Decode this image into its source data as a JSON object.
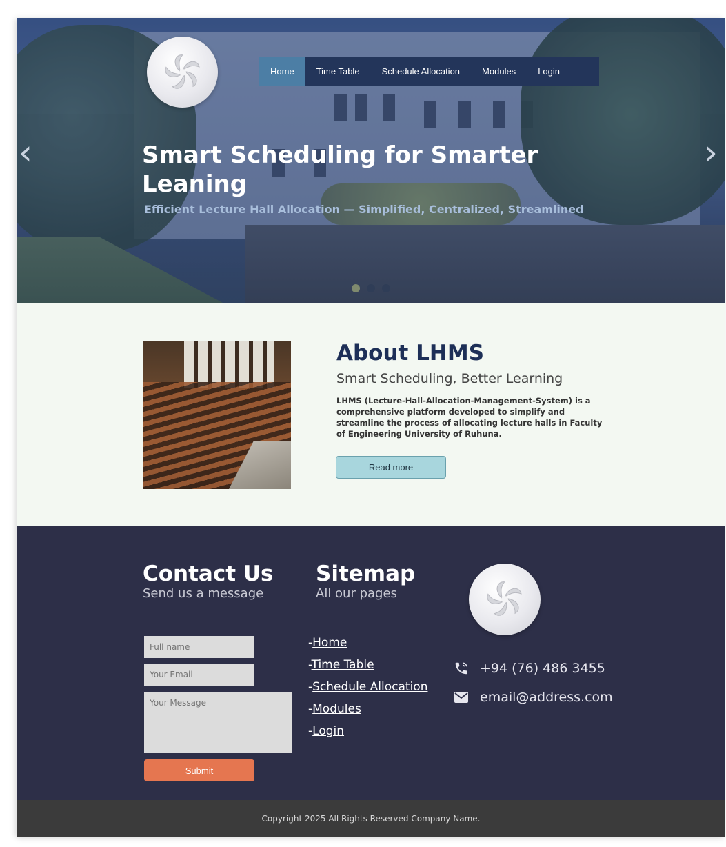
{
  "nav": {
    "items": [
      {
        "label": "Home",
        "active": true
      },
      {
        "label": "Time Table"
      },
      {
        "label": "Schedule Allocation"
      },
      {
        "label": "Modules"
      },
      {
        "label": "Login"
      }
    ]
  },
  "hero": {
    "title": "Smart Scheduling for Smarter Leaning",
    "subtitle": "Efficient Lecture Hall Allocation — Simplified, Centralized, Streamlined",
    "prev_icon": "chevron-left-icon",
    "next_icon": "chevron-right-icon",
    "slide_count": 3,
    "active_slide": 1
  },
  "about": {
    "title": "About LHMS",
    "subtitle": "Smart Scheduling, Better Learning",
    "text": "LHMS (Lecture-Hall-Allocation-Management-System) is a comprehensive platform developed to simplify and streamline the process of allocating lecture halls in Faculty of Engineering University of Ruhuna.",
    "button": "Read more"
  },
  "contact": {
    "title": "Contact Us",
    "subtitle": "Send us a message",
    "name_placeholder": "Full name",
    "email_placeholder": "Your Email",
    "message_placeholder": "Your Message",
    "submit": "Submit"
  },
  "sitemap": {
    "title": "Sitemap",
    "subtitle": "All our pages",
    "prefix": "-",
    "links": [
      "Home",
      "Time Table",
      "Schedule Allocation",
      "Modules",
      "Login"
    ]
  },
  "info": {
    "phone": "+94 (76) 486 3455",
    "email": "email@address.com",
    "phone_icon": "phone-icon",
    "email_icon": "envelope-icon"
  },
  "footer": {
    "copyright": "Copyright 2025 All Rights Reserved Company Name."
  },
  "colors": {
    "nav_bg": "#23355a",
    "nav_active": "#4c7ea5",
    "footer_bg": "#2d2f48",
    "about_bg": "#f3f8f2",
    "submit": "#e57650",
    "read_more": "#a8d6dd"
  }
}
